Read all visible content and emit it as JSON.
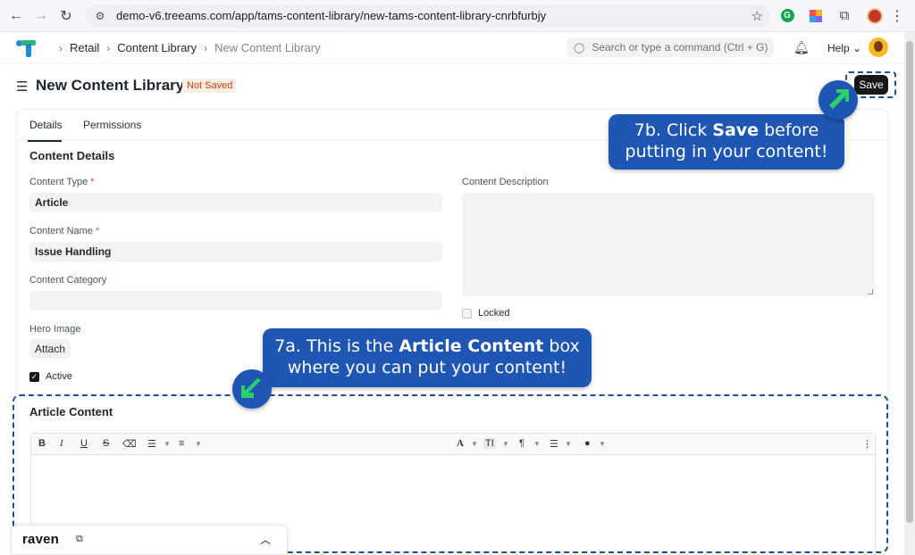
{
  "browser": {
    "url": "demo-v6.treeams.com/app/tams-content-library/new-tams-content-library-cnrbfurbjy"
  },
  "navbar": {
    "breadcrumbs": [
      "Retail",
      "Content Library",
      "New Content Library"
    ],
    "search_placeholder": "Search or type a command (Ctrl + G)",
    "help_label": "Help"
  },
  "page": {
    "title": "New Content Library",
    "status_badge": "Not Saved",
    "save_label": "Save"
  },
  "tabs": [
    "Details",
    "Permissions"
  ],
  "form": {
    "section_title": "Content Details",
    "content_type": {
      "label": "Content Type",
      "value": "Article",
      "required": "*"
    },
    "content_name": {
      "label": "Content Name",
      "value": "Issue Handling",
      "required": "*"
    },
    "content_category": {
      "label": "Content Category",
      "value": ""
    },
    "hero_image": {
      "label": "Hero Image",
      "button": "Attach"
    },
    "active": {
      "label": "Active",
      "checked": true
    },
    "content_description": {
      "label": "Content Description"
    },
    "locked": {
      "label": "Locked",
      "checked": false
    },
    "article_section_title": "Article Content"
  },
  "callouts": {
    "c7b_pre": "7b. Click ",
    "c7b_bold": "Save",
    "c7b_post": " before",
    "c7b_line2": "putting in your content!",
    "c7a_pre": "7a. This is the ",
    "c7a_bold": "Article Content",
    "c7a_post": " box",
    "c7a_line2": "where you can put your content!"
  },
  "raven": {
    "brand": "raven"
  },
  "colors": {
    "callout_blue": "#1f56b3",
    "arrow_green": "#2bd06a",
    "badge_text": "#c2410c",
    "badge_bg": "#fff0e6"
  }
}
